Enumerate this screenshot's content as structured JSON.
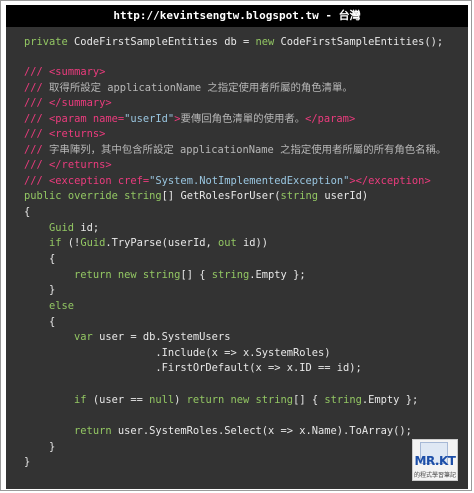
{
  "header": {
    "title": "http://kevintsengtw.blogspot.tw - 台灣"
  },
  "code_lines": [
    "private CodeFirstSampleEntities db = new CodeFirstSampleEntities();",
    "",
    "/// <summary>",
    "/// 取得所設定 applicationName 之指定使用者所屬的角色清單。",
    "/// </summary>",
    "/// <param name=\"userId\">要傳回角色清單的使用者。</param>",
    "/// <returns>",
    "/// 字串陣列，其中包含所設定 applicationName 之指定使用者所屬的所有角色名稱。",
    "/// </returns>",
    "/// <exception cref=\"System.NotImplementedException\"></exception>",
    "public override string[] GetRolesForUser(string userId)",
    "{",
    "    Guid id;",
    "    if (!Guid.TryParse(userId, out id))",
    "    {",
    "        return new string[] { string.Empty };",
    "    }",
    "    else",
    "    {",
    "        var user = db.SystemUsers",
    "                     .Include(x => x.SystemRoles)",
    "                     .FirstOrDefault(x => x.ID == id);",
    "",
    "        if (user == null) return new string[] { string.Empty };",
    "",
    "        return user.SystemRoles.Select(x => x.Name).ToArray();",
    "    }",
    "}"
  ],
  "logo": {
    "text": "MR.KT",
    "subtext": "的程式學習筆記"
  }
}
